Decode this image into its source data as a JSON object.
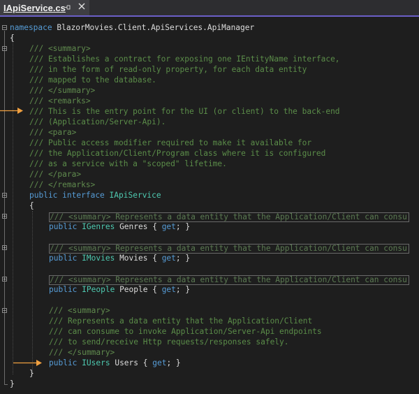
{
  "tab": {
    "title": "IApiService.cs",
    "pin_icon": "pin-icon",
    "close_icon": "close-icon"
  },
  "code": {
    "l1_kw": "namespace",
    "l1_rest": " BlazorMovies.Client.ApiServices.ApiManager",
    "l2": "{",
    "doc": [
      "/// <summary>",
      "/// Establishes a contract for exposing one IEntityName interface,",
      "/// in the form of read-only property, for each data entity",
      "/// mapped to the database.",
      "/// </summary>",
      "/// <remarks>",
      "/// This is the entry point for the UI (or client) to the back-end",
      "/// (Application/Server-Api).",
      "/// <para>",
      "/// Public access modifier required to make it available for",
      "/// the Application/Client/Program class where it is configured",
      "/// as a service with a \"scoped\" lifetime.",
      "/// </para>",
      "/// </remarks>"
    ],
    "iface_kw1": "public",
    "iface_kw2": "interface",
    "iface_name": "IApiService",
    "open_brace": "{",
    "collapsed_genres": "/// <summary> Represents a data entity that the Application/Client can consu",
    "collapsed_movies": "/// <summary> Represents a data entity that the Application/Client can consu",
    "collapsed_people": "/// <summary> Represents a data entity that the Application/Client can consu",
    "prop_genres": {
      "kw": "public",
      "type": "IGenres",
      "name": " Genres { ",
      "get": "get",
      "end": "; }"
    },
    "prop_movies": {
      "kw": "public",
      "type": "IMovies",
      "name": " Movies { ",
      "get": "get",
      "end": "; }"
    },
    "prop_people": {
      "kw": "public",
      "type": "IPeople",
      "name": " People { ",
      "get": "get",
      "end": "; }"
    },
    "users_doc": [
      "/// <summary>",
      "/// Represents a data entity that the Application/Client",
      "/// can consume to invoke Application/Server-Api endpoints",
      "/// to send/receive Http requests/responses safely.",
      "/// </summary>"
    ],
    "prop_users": {
      "kw": "public",
      "type": "IUsers",
      "name": " Users { ",
      "get": "get",
      "end": "; }"
    },
    "close_iface": "}",
    "close_ns": "}"
  },
  "colors": {
    "keyword": "#569cd6",
    "type": "#4ec9b0",
    "comment": "#57a64a",
    "arrow": "#f0a040"
  }
}
